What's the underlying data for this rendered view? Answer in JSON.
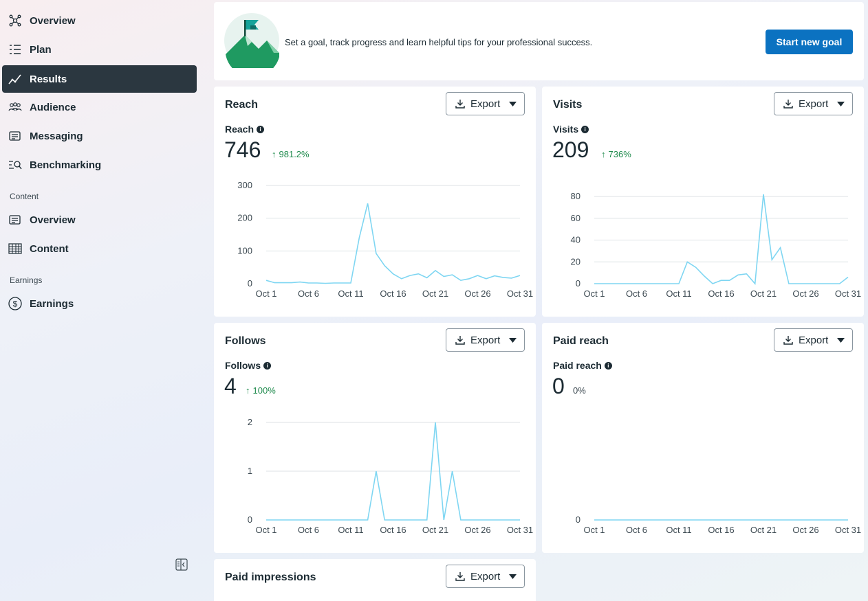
{
  "sidebar": {
    "items": [
      {
        "label": "Overview",
        "icon": "network-icon"
      },
      {
        "label": "Plan",
        "icon": "list-icon"
      },
      {
        "label": "Results",
        "icon": "trend-icon",
        "active": true
      },
      {
        "label": "Audience",
        "icon": "people-icon"
      },
      {
        "label": "Messaging",
        "icon": "messages-icon"
      },
      {
        "label": "Benchmarking",
        "icon": "benchmark-icon"
      }
    ],
    "content_section": {
      "heading": "Content",
      "items": [
        {
          "label": "Overview",
          "icon": "messages-icon"
        },
        {
          "label": "Content",
          "icon": "table-icon"
        }
      ]
    },
    "earnings_section": {
      "heading": "Earnings",
      "items": [
        {
          "label": "Earnings",
          "icon": "dollar-icon"
        }
      ]
    }
  },
  "goal": {
    "text": "Set a goal, track progress and learn helpful tips for your professional success.",
    "button": "Start new goal"
  },
  "export_label": "Export",
  "colors": {
    "accent": "#0b72c1",
    "line": "#7fd6f2",
    "positive": "#1e8a4c",
    "active_nav": "#2b3740"
  },
  "chart_data": [
    {
      "type": "line",
      "title": "Reach",
      "metric_label": "Reach",
      "total": "746",
      "change": "981.2%",
      "change_dir": "up",
      "x_ticks": [
        "Oct 1",
        "Oct 6",
        "Oct 11",
        "Oct 16",
        "Oct 21",
        "Oct 26",
        "Oct 31"
      ],
      "y_ticks": [
        0,
        100,
        200,
        300
      ],
      "ylim": [
        0,
        300
      ],
      "values": [
        10,
        3,
        3,
        3,
        5,
        2,
        2,
        1,
        2,
        2,
        2,
        140,
        245,
        92,
        55,
        30,
        15,
        25,
        30,
        18,
        40,
        22,
        27,
        10,
        15,
        25,
        15,
        24,
        19,
        17,
        25
      ]
    },
    {
      "type": "line",
      "title": "Visits",
      "metric_label": "Visits",
      "total": "209",
      "change": "736%",
      "change_dir": "up",
      "x_ticks": [
        "Oct 1",
        "Oct 6",
        "Oct 11",
        "Oct 16",
        "Oct 21",
        "Oct 26",
        "Oct 31"
      ],
      "y_ticks": [
        0,
        20,
        40,
        60,
        80
      ],
      "ylim": [
        0,
        80
      ],
      "values": [
        0,
        0,
        0,
        0,
        0,
        0,
        0,
        0,
        0,
        0,
        0,
        20,
        15,
        7,
        0,
        3,
        3,
        8,
        9,
        0,
        82,
        22,
        33,
        0,
        0,
        0,
        0,
        0,
        0,
        0,
        6
      ]
    },
    {
      "type": "line",
      "title": "Follows",
      "metric_label": "Follows",
      "total": "4",
      "change": "100%",
      "change_dir": "up",
      "x_ticks": [
        "Oct 1",
        "Oct 6",
        "Oct 11",
        "Oct 16",
        "Oct 21",
        "Oct 26",
        "Oct 31"
      ],
      "y_ticks": [
        0,
        1,
        2
      ],
      "ylim": [
        0,
        2
      ],
      "values": [
        0,
        0,
        0,
        0,
        0,
        0,
        0,
        0,
        0,
        0,
        0,
        0,
        0,
        1,
        0,
        0,
        0,
        0,
        0,
        0,
        2,
        0,
        1,
        0,
        0,
        0,
        0,
        0,
        0,
        0,
        0
      ]
    },
    {
      "type": "line",
      "title": "Paid reach",
      "metric_label": "Paid reach",
      "total": "0",
      "change": "0%",
      "change_dir": "none",
      "x_ticks": [
        "Oct 1",
        "Oct 6",
        "Oct 11",
        "Oct 16",
        "Oct 21",
        "Oct 26",
        "Oct 31"
      ],
      "y_ticks": [
        0
      ],
      "ylim": [
        0,
        1
      ],
      "values": [
        0,
        0,
        0,
        0,
        0,
        0,
        0,
        0,
        0,
        0,
        0,
        0,
        0,
        0,
        0,
        0,
        0,
        0,
        0,
        0,
        0,
        0,
        0,
        0,
        0,
        0,
        0,
        0,
        0,
        0,
        0
      ]
    }
  ],
  "paid_impressions": {
    "title": "Paid impressions"
  }
}
